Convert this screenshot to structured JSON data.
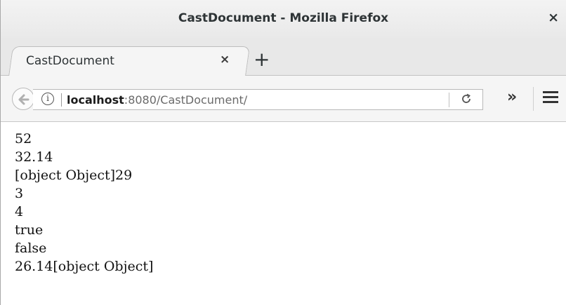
{
  "window": {
    "title": "CastDocument - Mozilla Firefox",
    "close_glyph": "×"
  },
  "tabs": [
    {
      "label": "CastDocument",
      "close_glyph": "×"
    }
  ],
  "new_tab_glyph": "+",
  "navbar": {
    "url_host": "localhost",
    "url_rest": ":8080/CastDocument/",
    "info_glyph": "i",
    "reload_glyph": "C",
    "overflow_glyph": "»"
  },
  "output_lines": [
    "52",
    "32.14",
    "[object Object]29",
    "3",
    "4",
    "true",
    "false",
    "26.14[object Object]"
  ],
  "icons": [
    "back-arrow-icon",
    "info-icon",
    "reload-icon",
    "overflow-chevron-icon",
    "hamburger-menu-icon",
    "close-icon",
    "plus-icon"
  ]
}
